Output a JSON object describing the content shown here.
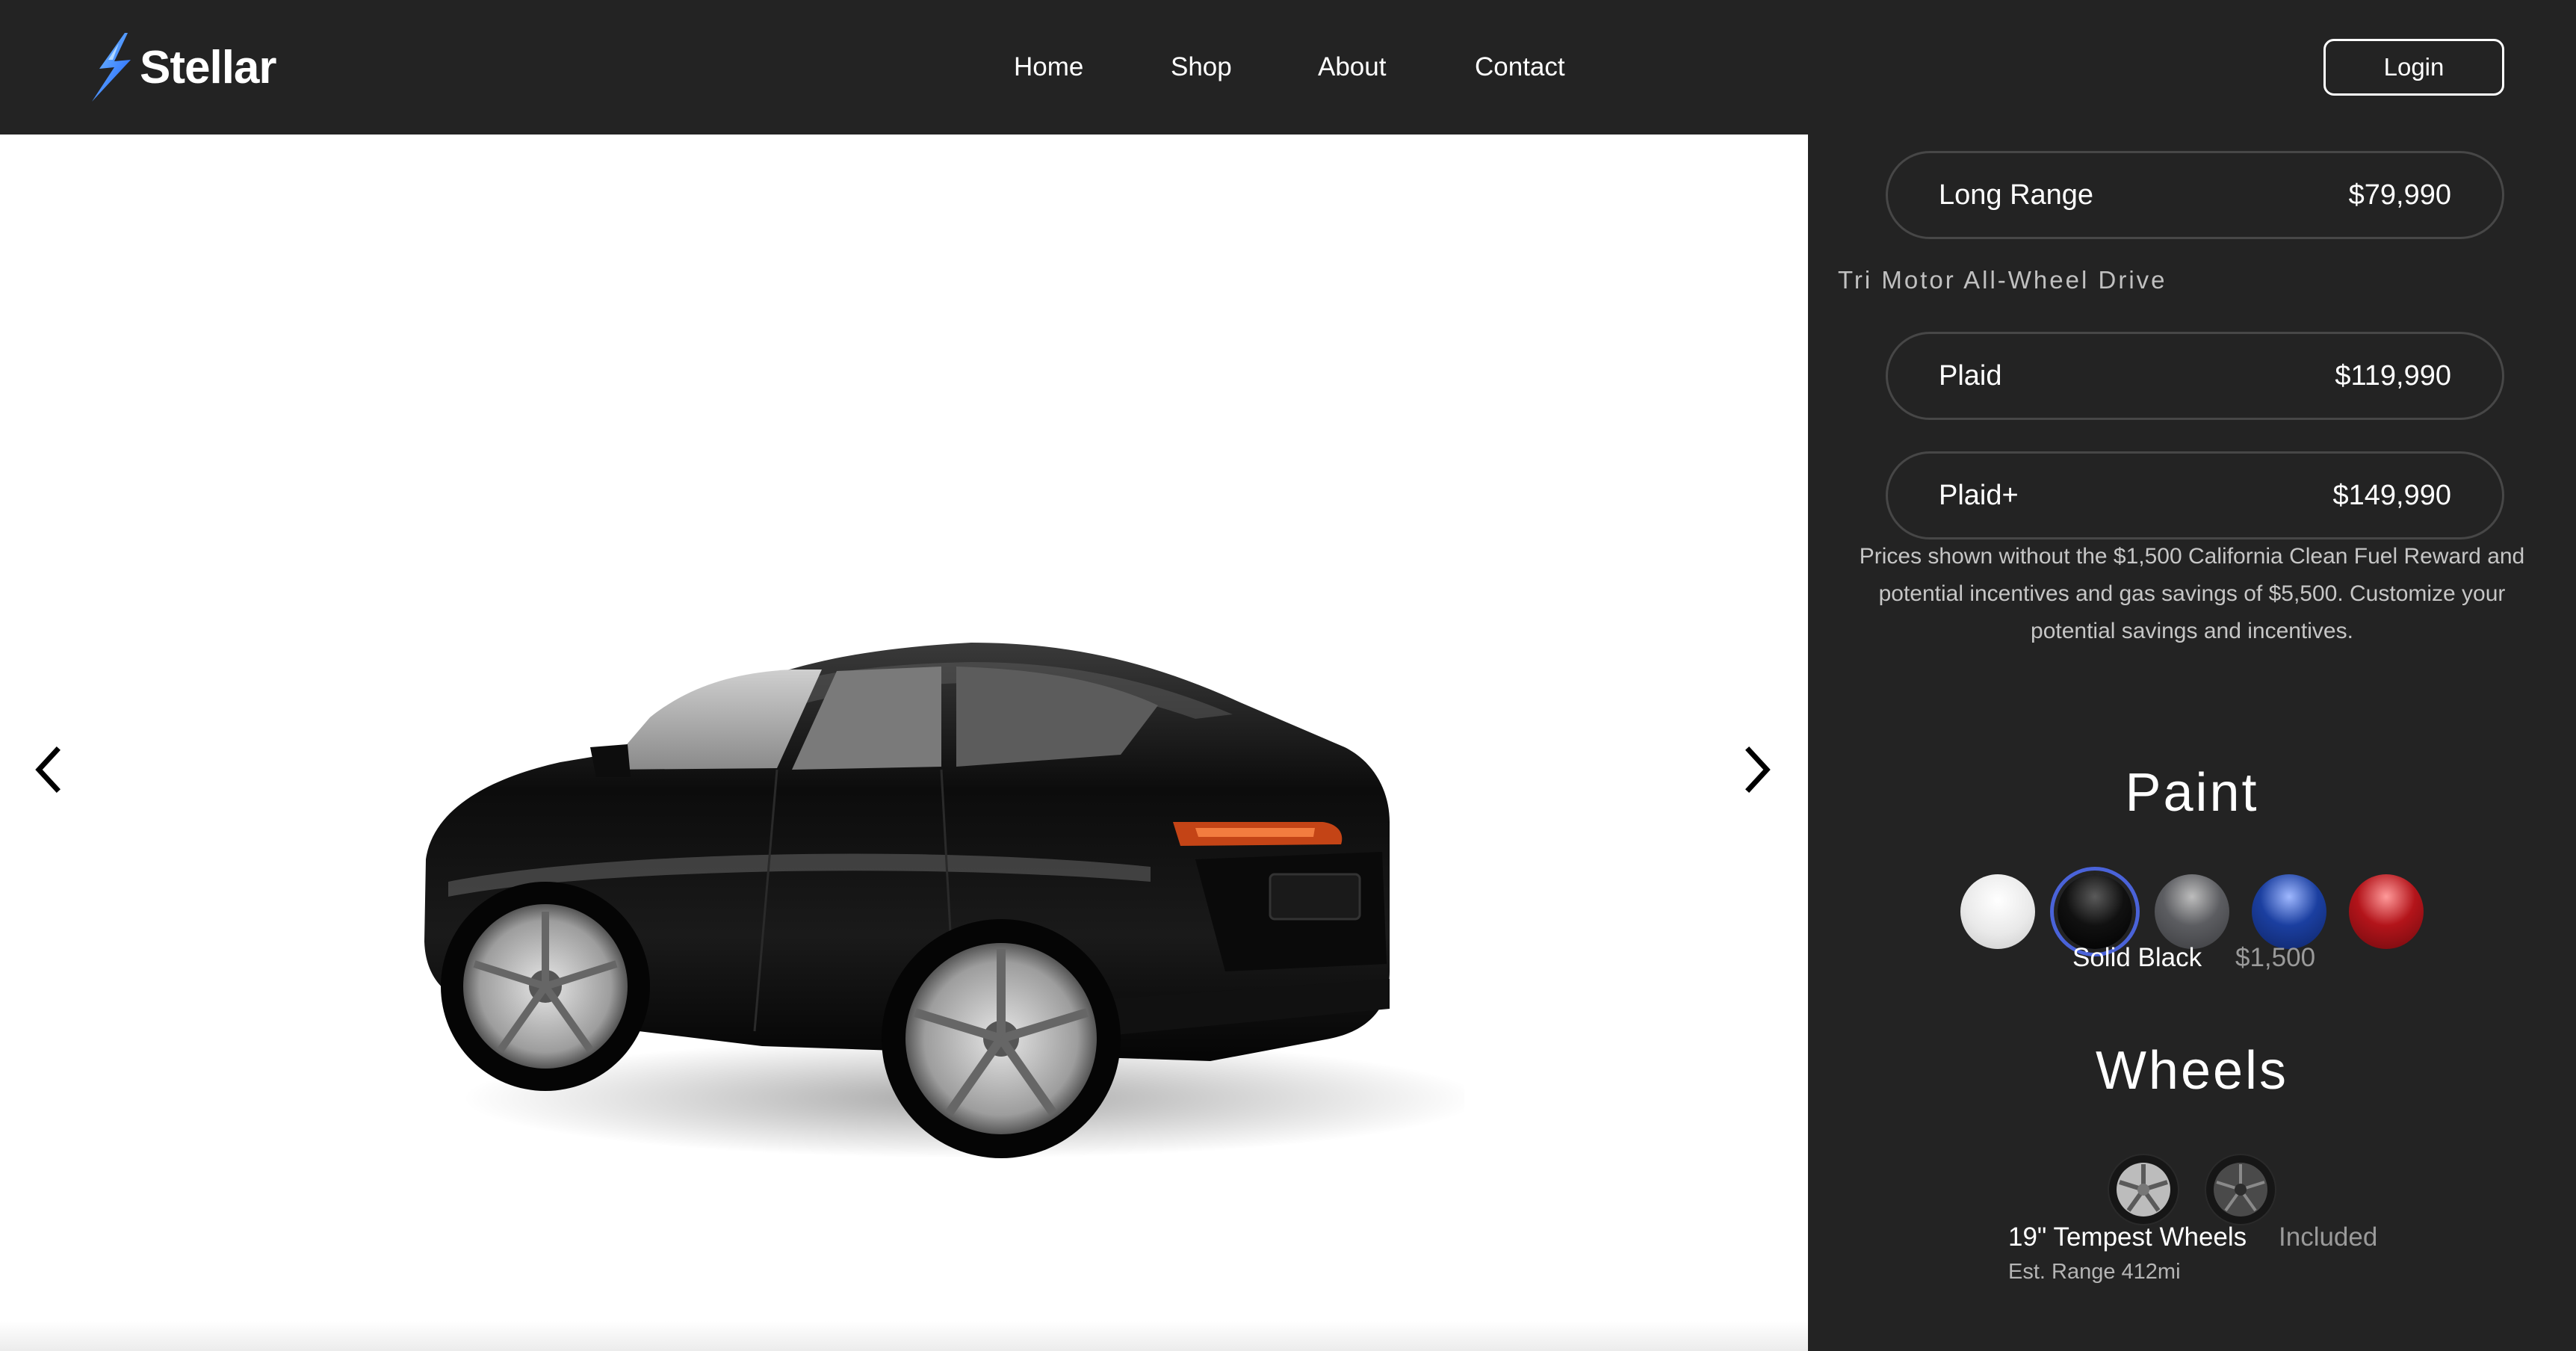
{
  "nav": {
    "brand": "Stellar",
    "links": [
      "Home",
      "Shop",
      "About",
      "Contact"
    ],
    "login_label": "Login"
  },
  "viewer": {
    "prev_icon": "chevron-left-icon",
    "next_icon": "chevron-right-icon",
    "car_color": "#0e0e0e"
  },
  "trims": [
    {
      "name": "Long Range",
      "price": "$79,990"
    },
    {
      "name": "Plaid",
      "price": "$119,990"
    },
    {
      "name": "Plaid+",
      "price": "$149,990"
    }
  ],
  "drive_heading": "Tri Motor All-Wheel Drive",
  "price_note": "Prices shown without the $1,500 California Clean Fuel Reward and potential incentives and gas savings of $5,500. Customize your potential savings and incentives.",
  "paint": {
    "title": "Paint",
    "swatches": [
      {
        "name": "white",
        "color": "#f4f4f4"
      },
      {
        "name": "black",
        "color": "#111111",
        "selected": true
      },
      {
        "name": "gray",
        "color": "#5c5d61"
      },
      {
        "name": "blue",
        "color": "#1b3fa0"
      },
      {
        "name": "red",
        "color": "#b3141a"
      }
    ],
    "selected_label": "Solid Black",
    "selected_price": "$1,500",
    "accent": "#4a63d9"
  },
  "wheels": {
    "title": "Wheels",
    "options": [
      {
        "name": "tempest-wheel-silver"
      },
      {
        "name": "arachnid-wheel-dark"
      }
    ],
    "selected_label": "19\" Tempest Wheels",
    "selected_price": "Included",
    "range": "Est. Range 412mi"
  }
}
